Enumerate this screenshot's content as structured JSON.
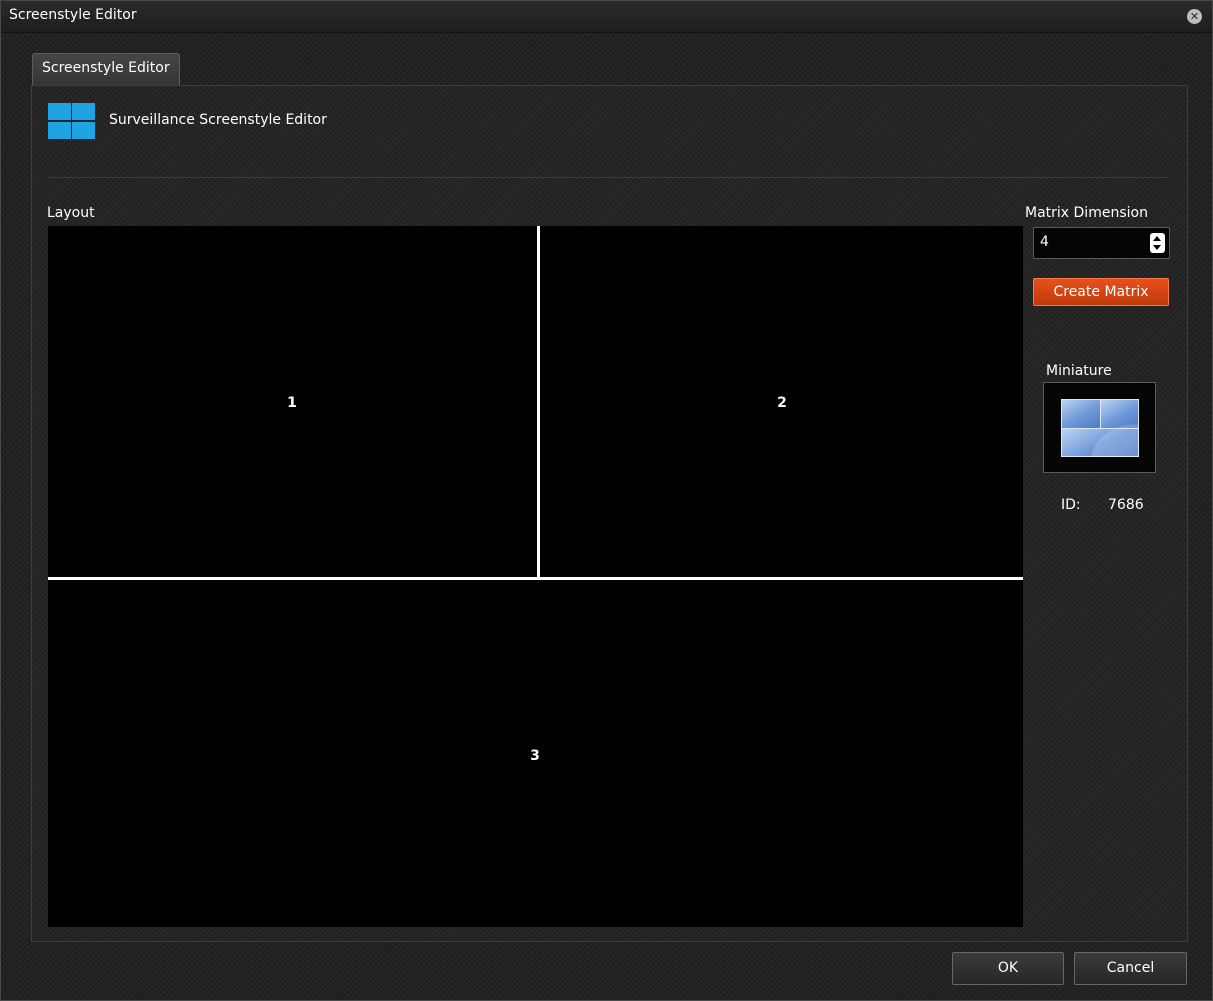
{
  "window": {
    "title": "Screenstyle Editor"
  },
  "tabs": [
    {
      "label": "Screenstyle Editor",
      "active": true
    }
  ],
  "header": {
    "title": "Surveillance Screenstyle Editor",
    "icon": "layout-grid-icon",
    "icon_color": "#1fa3e3"
  },
  "layout": {
    "label": "Layout",
    "cells": [
      "1",
      "2",
      "3"
    ]
  },
  "matrix": {
    "label": "Matrix Dimension",
    "value": "4",
    "create_button": "Create Matrix",
    "create_button_color": "#d9460f"
  },
  "miniature": {
    "label": "Miniature"
  },
  "id": {
    "label": "ID:",
    "value": "7686"
  },
  "footer": {
    "ok": "OK",
    "cancel": "Cancel"
  }
}
